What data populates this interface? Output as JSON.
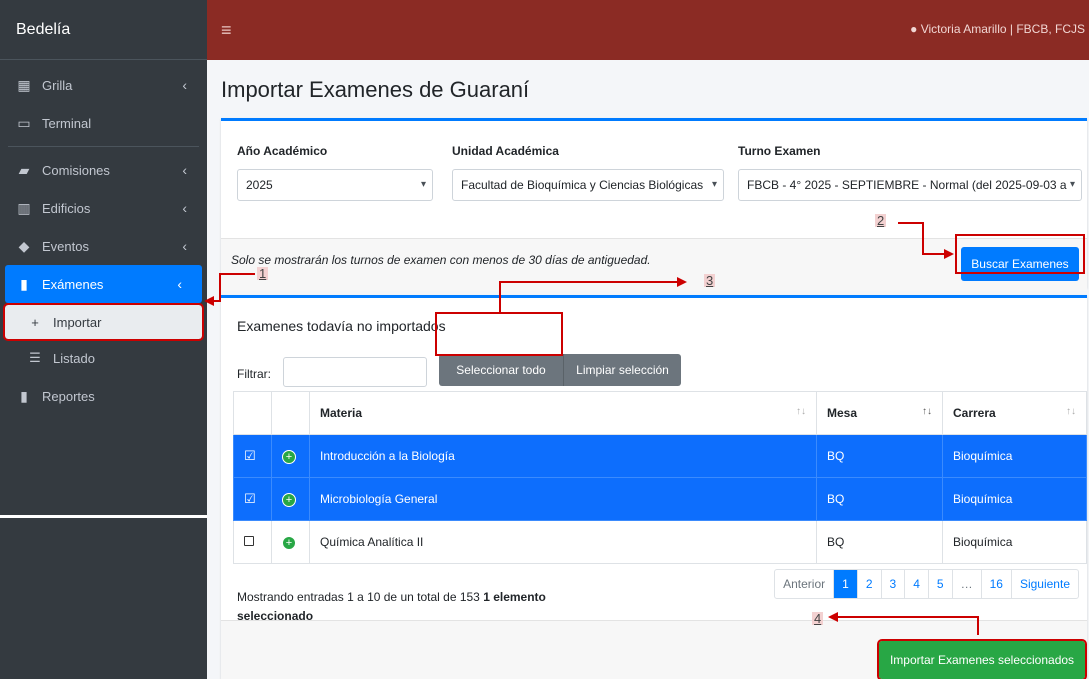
{
  "sidebar": {
    "brand": "Bedelía",
    "items": [
      {
        "label": "Grilla",
        "icon": "calendar-grid-icon",
        "chevron": "‹"
      },
      {
        "label": "Terminal",
        "icon": "monitor-icon",
        "chevron": ""
      },
      {
        "label": "Comisiones",
        "icon": "folder-icon",
        "chevron": "‹"
      },
      {
        "label": "Edificios",
        "icon": "building-icon",
        "chevron": "‹"
      },
      {
        "label": "Eventos",
        "icon": "graduation-cap-icon",
        "chevron": "‹"
      },
      {
        "label": "Exámenes",
        "icon": "file-icon",
        "chevron": "‹"
      }
    ],
    "sub_items": [
      {
        "label": "Importar",
        "icon": "plus-icon"
      },
      {
        "label": "Listado",
        "icon": "list-icon"
      }
    ],
    "reportes": "Reportes"
  },
  "topbar": {
    "menu_icon": "≡",
    "user": "Victoria Amarillo | FBCB, FCJS"
  },
  "page_title": "Importar Examenes de Guaraní",
  "filters": {
    "anio_label": "Año Académico",
    "anio_value": "2025",
    "unidad_label": "Unidad Académica",
    "unidad_value": "Facultad de Bioquímica y Ciencias Biológicas",
    "turno_label": "Turno Examen",
    "turno_value": "FBCB - 4° 2025 - SEPTIEMBRE - Normal (del 2025-09-03 a"
  },
  "note": "Solo se mostrarán los turnos de examen con menos de 30 días de antiguedad.",
  "buscar_button": "Buscar Examenes",
  "list": {
    "title": "Examenes todavía no importados",
    "filter_label": "Filtrar:",
    "select_all": "Seleccionar todo",
    "clear_selection": "Limpiar selección",
    "columns": [
      "Materia",
      "Mesa",
      "Carrera"
    ],
    "rows": [
      {
        "materia": "Introducción a la Biología",
        "mesa": "BQ",
        "carrera": "Bioquímica",
        "selected": true
      },
      {
        "materia": "Microbiología General",
        "mesa": "BQ",
        "carrera": "Bioquímica",
        "selected": true
      },
      {
        "materia": "Química Analítica II",
        "mesa": "BQ",
        "carrera": "Bioquímica",
        "selected": false
      }
    ],
    "info": "Mostrando entradas 1 a 10 de un total de 153",
    "selected_info": "1 elemento seleccionado",
    "pager": {
      "prev": "Anterior",
      "pages": [
        "1",
        "2",
        "3",
        "4",
        "5",
        "…",
        "16"
      ],
      "next": "Siguiente"
    }
  },
  "import_button": "Importar Examenes seleccionados",
  "annotations": [
    "1",
    "2",
    "3",
    "4"
  ],
  "colors": {
    "accent": "#007bff",
    "topbar": "#8b2b24",
    "success": "#28a745",
    "annotation": "#cc0000"
  }
}
